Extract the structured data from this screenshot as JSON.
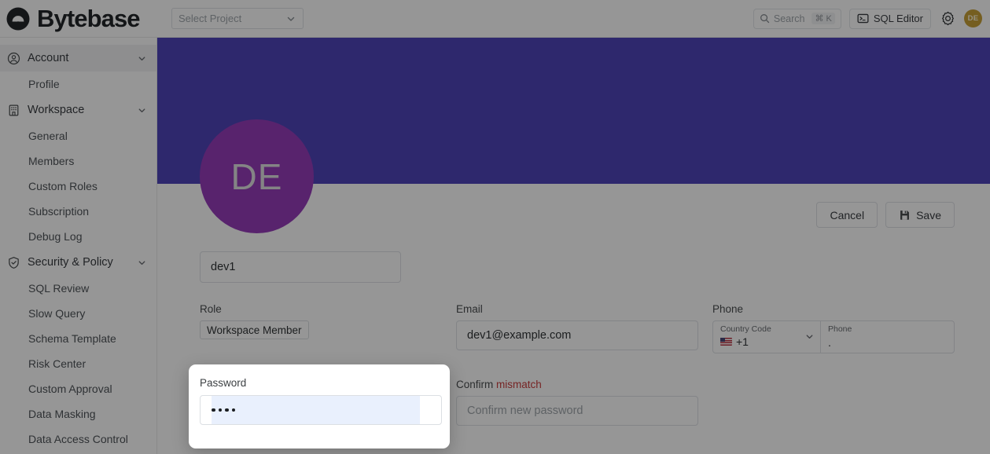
{
  "brand": {
    "name": "Bytebase",
    "logo_icon": "bytebase-logo-icon"
  },
  "topbar": {
    "project_select": {
      "placeholder": "Select Project",
      "chevron_icon": "chevron-down-icon"
    },
    "search": {
      "label": "Search",
      "shortcut": "⌘ K",
      "icon": "search-icon"
    },
    "sql_editor": {
      "label": "SQL Editor",
      "icon": "terminal-icon"
    },
    "settings_icon": "gear-icon",
    "avatar": {
      "initials": "DE",
      "color": "#c49a28"
    }
  },
  "sidebar": {
    "groups": [
      {
        "label": "Account",
        "icon": "user-circle-icon",
        "chevron": "chevron-down-icon",
        "active": true,
        "items": [
          {
            "label": "Profile"
          }
        ]
      },
      {
        "label": "Workspace",
        "icon": "building-icon",
        "chevron": "chevron-down-icon",
        "active": false,
        "items": [
          {
            "label": "General"
          },
          {
            "label": "Members"
          },
          {
            "label": "Custom Roles"
          },
          {
            "label": "Subscription"
          },
          {
            "label": "Debug Log"
          }
        ]
      },
      {
        "label": "Security & Policy",
        "icon": "shield-check-icon",
        "chevron": "chevron-down-icon",
        "active": false,
        "items": [
          {
            "label": "SQL Review"
          },
          {
            "label": "Slow Query"
          },
          {
            "label": "Schema Template"
          },
          {
            "label": "Risk Center"
          },
          {
            "label": "Custom Approval"
          },
          {
            "label": "Data Masking"
          },
          {
            "label": "Data Access Control"
          }
        ]
      }
    ]
  },
  "profile": {
    "banner_color": "#4338b5",
    "avatar": {
      "initials": "DE",
      "color": "#8e2fb4"
    },
    "name_value": "dev1",
    "actions": {
      "cancel_label": "Cancel",
      "save_label": "Save",
      "save_icon": "save-icon"
    },
    "role": {
      "label": "Role",
      "value": "Workspace Member"
    },
    "email": {
      "label": "Email",
      "value": "dev1@example.com"
    },
    "phone": {
      "label": "Phone",
      "country_code_label": "Country Code",
      "country_code_value": "+1",
      "country_flag_icon": "us-flag-icon",
      "chevron_icon": "chevron-down-icon",
      "phone_label": "Phone",
      "phone_value": "."
    },
    "password": {
      "label": "Password",
      "masked_value": "••••",
      "dot_count": 4
    },
    "confirm": {
      "label": "Confirm",
      "error": "mismatch",
      "placeholder": "Confirm new password",
      "error_color": "#c53030"
    }
  }
}
